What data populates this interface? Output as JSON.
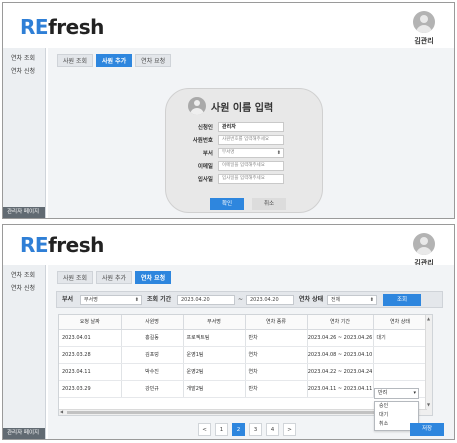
{
  "logo": {
    "accent": "RE",
    "rest": "fresh"
  },
  "user": {
    "name": "김관리"
  },
  "sidebar": {
    "items": [
      {
        "label": "연차 조회"
      },
      {
        "label": "연차 신청"
      }
    ],
    "footer": "관리자 페이지"
  },
  "screen1": {
    "tabs": [
      {
        "label": "사원 조회"
      },
      {
        "label": "사원 추가"
      },
      {
        "label": "연차 요청"
      }
    ],
    "form": {
      "title": "사원 이름 입력",
      "fields": [
        {
          "label": "신청인",
          "value": "관리자"
        },
        {
          "label": "사원번호",
          "placeholder": "사원번호를 입력해주세요"
        },
        {
          "label": "부서",
          "value": "부서명"
        },
        {
          "label": "이메일",
          "placeholder": "이메일을 입력해주세요"
        },
        {
          "label": "입사일",
          "placeholder": "입사일을 입력해주세요"
        }
      ],
      "confirm": "확인",
      "cancel": "취소"
    }
  },
  "screen2": {
    "tabs": [
      {
        "label": "사원 조회"
      },
      {
        "label": "사원 추가"
      },
      {
        "label": "연차 요청"
      }
    ],
    "filter": {
      "dept_label": "부서",
      "dept_value": "부서명",
      "period_label": "조회 기간",
      "date_from": "2023.04.20",
      "tilde": "~",
      "date_to": "2023.04.20",
      "status_label": "연차 상태",
      "status_value": "전체",
      "search": "조회"
    },
    "table": {
      "headers": [
        "요청 날짜",
        "사원명",
        "부서명",
        "연차 종류",
        "연차 기간",
        "연차 상태"
      ],
      "rows": [
        [
          "2023.04.01",
          "홍길동",
          "프로젝트팀",
          "반차",
          "2023.04.26 ~ 2023.04.26",
          "대기"
        ],
        [
          "2023.03.28",
          "김포덩",
          "운영1팀",
          "연차",
          "2023.04.08 ~ 2023.04.10",
          ""
        ],
        [
          "2023.04.11",
          "박수진",
          "운영2팀",
          "연차",
          "2023.04.22 ~ 2023.04.24",
          ""
        ],
        [
          "2023.03.29",
          "강민규",
          "개발2팀",
          "반차",
          "2023.04.11 ~ 2023.04.11",
          ""
        ]
      ]
    },
    "status_dropdown": {
      "selected": "반려",
      "options": [
        "승인",
        "대기",
        "취소"
      ]
    },
    "pager": {
      "prev": "<",
      "pages": [
        "1",
        "2",
        "3",
        "4"
      ],
      "next": ">",
      "active": "2"
    },
    "submit": "저장"
  },
  "colors": {
    "accent": "#2e86de",
    "sidebar_bg": "#eceff2",
    "footer_bg": "#616a72"
  }
}
